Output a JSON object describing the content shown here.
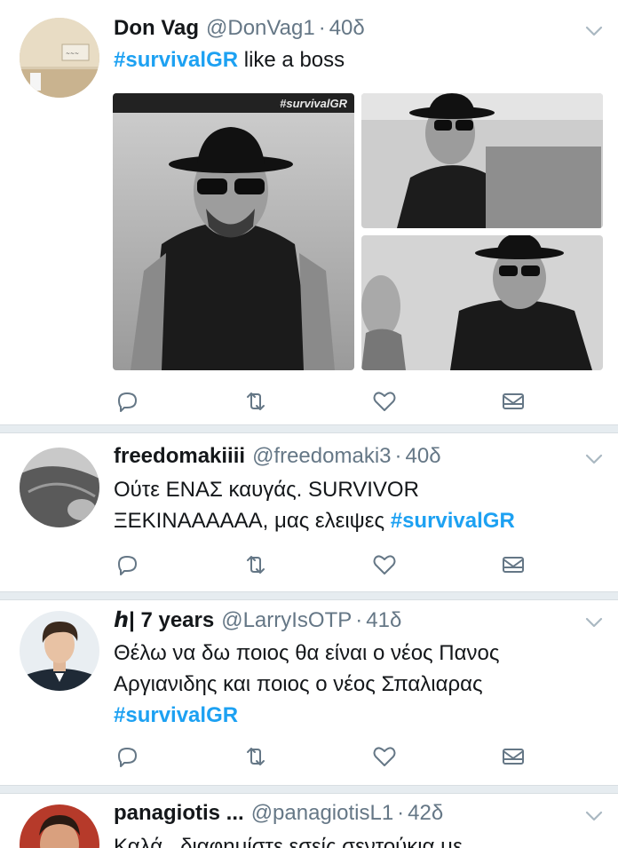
{
  "tweets": [
    {
      "name": "Don Vag",
      "handle": "@DonVag1",
      "separator": "·",
      "time": "40δ",
      "text_parts": [
        {
          "text": "#survivalGR",
          "hashtag": true
        },
        {
          "text": " like a boss",
          "hashtag": false
        }
      ],
      "media_watermark": "#survivalGR"
    },
    {
      "name": "freedomakiiii",
      "handle": "@freedomaki3",
      "separator": "·",
      "time": "40δ",
      "text_line1": "Ούτε ΕΝΑΣ καυγάς. SURVIVOR",
      "text_line2": "ΞΕΚΙΝΑΑΑΑΑΑ, μας ελειψες",
      "hashtag": "#survivalGR"
    },
    {
      "name": "ℎ| 7 years",
      "handle": "@LarryIsOTP",
      "separator": "·",
      "time": "41δ",
      "text_line1": "Θέλω να δω ποιος θα είναι ο νέος Πανος",
      "text_line2": "Αργιανιδης και ποιος ο νέος Σπαλιαρας",
      "hashtag": "#survivalGR"
    },
    {
      "name": "panagiotis ...",
      "handle": "@panagiotisL1",
      "separator": "·",
      "time": "42δ",
      "text_line1": "Καλά...διαφημίστε εσείς σεντούκια με"
    }
  ],
  "icons": {
    "reply": "reply-icon",
    "retweet": "retweet-icon",
    "like": "heart-icon",
    "dm": "envelope-icon",
    "more": "chevron-down-icon"
  },
  "colors": {
    "hashtag": "#1da1f2",
    "muted": "#657786",
    "divider": "#e6ecf0"
  }
}
